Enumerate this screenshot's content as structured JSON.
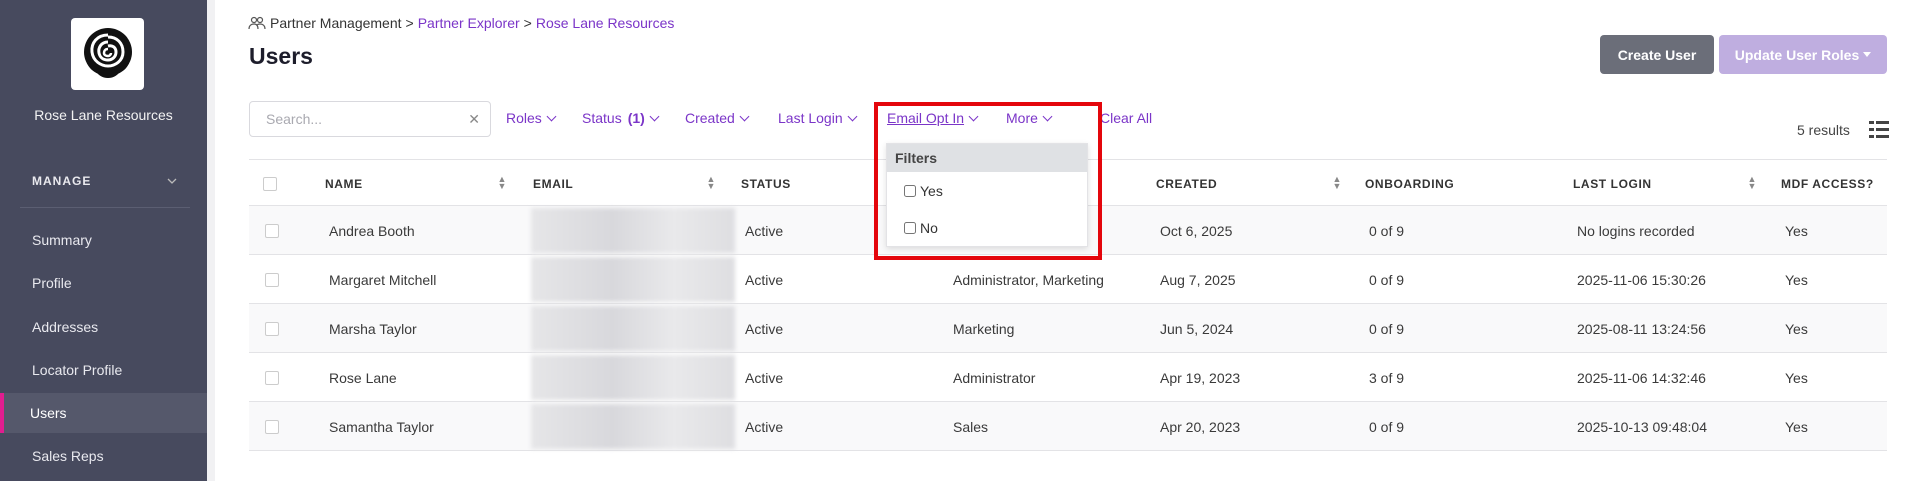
{
  "sidebar": {
    "company_name": "Rose Lane Resources",
    "section_label": "MANAGE",
    "items": [
      {
        "label": "Summary"
      },
      {
        "label": "Profile"
      },
      {
        "label": "Addresses"
      },
      {
        "label": "Locator Profile"
      },
      {
        "label": "Users"
      },
      {
        "label": "Sales Reps"
      }
    ],
    "active_item": "Users",
    "active_color": "#e11d8f"
  },
  "breadcrumb": {
    "root": "Partner Management",
    "sep": ">",
    "items": [
      "Partner Explorer",
      "Rose Lane Resources"
    ]
  },
  "page_title": "Users",
  "actions": {
    "create_label": "Create User",
    "update_label": "Update User Roles"
  },
  "search": {
    "placeholder": "Search...",
    "value": ""
  },
  "filters": [
    {
      "label": "Roles"
    },
    {
      "label": "Status",
      "count": "(1)"
    },
    {
      "label": "Created"
    },
    {
      "label": "Last Login"
    },
    {
      "label": "Email Opt In",
      "open": true
    },
    {
      "label": "More"
    }
  ],
  "clear_all": "Clear All",
  "results": "5 results",
  "dropdown": {
    "title": "Filters",
    "options": [
      {
        "label": "Yes",
        "checked": false
      },
      {
        "label": "No",
        "checked": false
      }
    ]
  },
  "table": {
    "columns": [
      "NAME",
      "EMAIL",
      "STATUS",
      "",
      "CREATED",
      "ONBOARDING",
      "LAST LOGIN",
      "MDF ACCESS?"
    ],
    "rows": [
      {
        "name": "Andrea Booth",
        "status": "Active",
        "roles": "",
        "created": "Oct 6, 2025",
        "onboarding": "0 of 9",
        "last_login": "No logins recorded",
        "mdf": "Yes"
      },
      {
        "name": "Margaret Mitchell",
        "status": "Active",
        "roles": "Administrator, Marketing",
        "created": "Aug 7, 2025",
        "onboarding": "0 of 9",
        "last_login": "2025-11-06 15:30:26",
        "mdf": "Yes"
      },
      {
        "name": "Marsha Taylor",
        "status": "Active",
        "roles": "Marketing",
        "created": "Jun 5, 2024",
        "onboarding": "0 of 9",
        "last_login": "2025-08-11 13:24:56",
        "mdf": "Yes"
      },
      {
        "name": "Rose Lane",
        "status": "Active",
        "roles": "Administrator",
        "created": "Apr 19, 2023",
        "onboarding": "3 of 9",
        "last_login": "2025-11-06 14:32:46",
        "mdf": "Yes"
      },
      {
        "name": "Samantha Taylor",
        "status": "Active",
        "roles": "Sales",
        "created": "Apr 20, 2023",
        "onboarding": "0 of 9",
        "last_login": "2025-10-13 09:48:04",
        "mdf": "Yes"
      }
    ]
  },
  "colors": {
    "accent": "#7b35c8",
    "highlight": "#e4060c",
    "sidebar_bg": "#474a5e"
  },
  "icons": [
    "rose-logo-icon",
    "chevron-down-icon",
    "people-icon",
    "close-icon",
    "sort-icon",
    "grid-view-icon"
  ]
}
